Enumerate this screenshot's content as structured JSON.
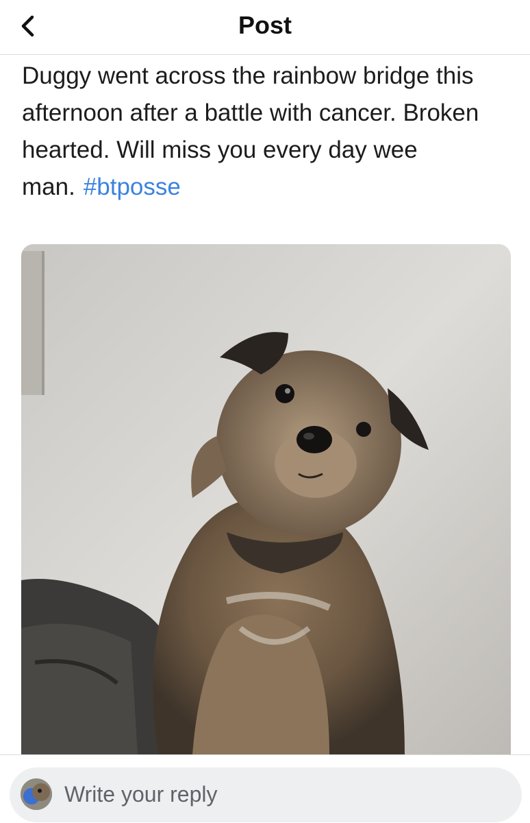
{
  "header": {
    "title": "Post",
    "back_icon": "chevron-left-icon"
  },
  "post": {
    "text": "Duggy went across the rainbow bridge this afternoon after a battle with cancer. Broken hearted. Will miss you every day wee man.",
    "hashtag": "#btposse",
    "hashtag_color": "#3b82e0",
    "image_description": "photo"
  },
  "reply": {
    "placeholder": "Write your reply",
    "avatar_icon": "user-avatar"
  }
}
